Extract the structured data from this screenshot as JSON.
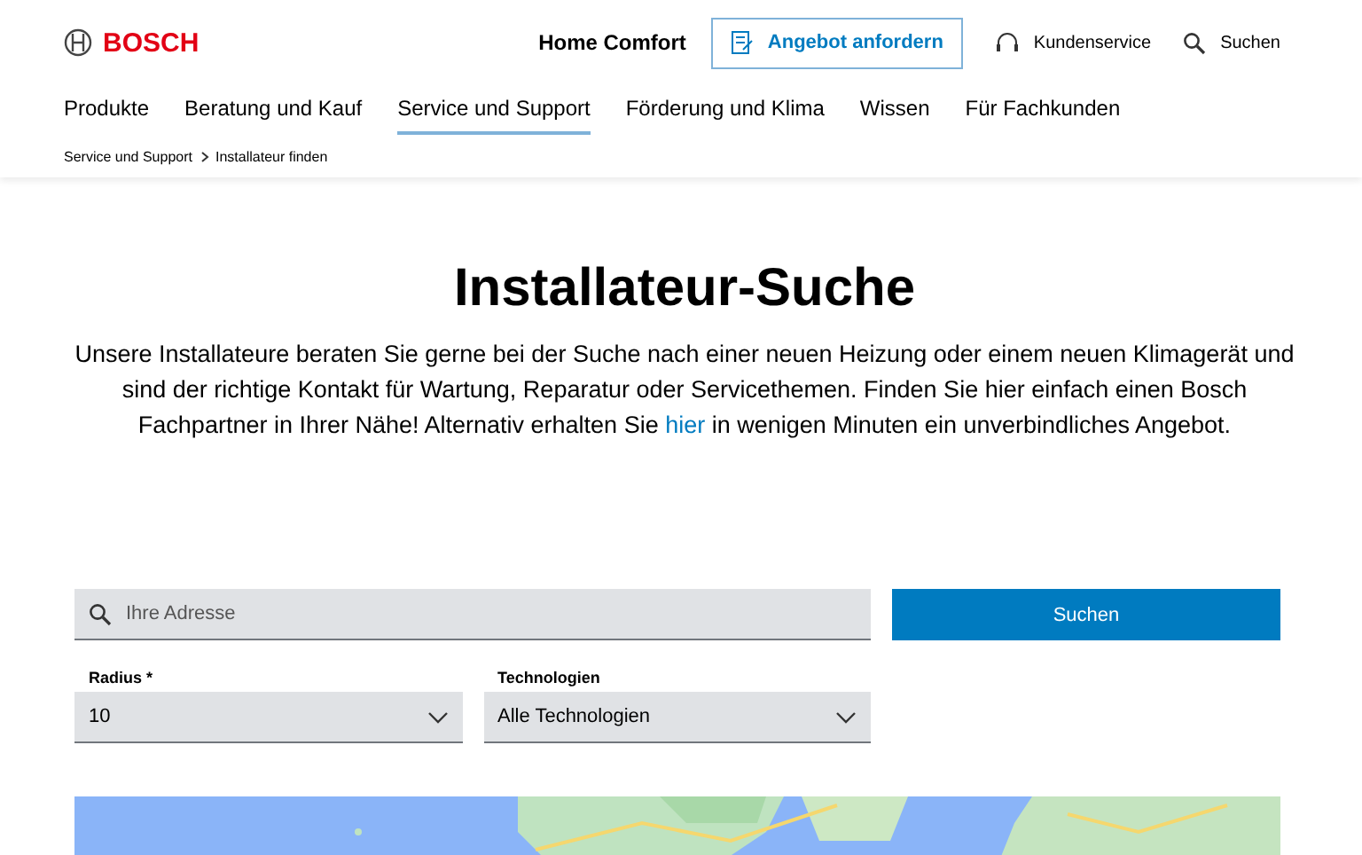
{
  "brand": "BOSCH",
  "header": {
    "title": "Home Comfort",
    "cta": "Angebot anfordern",
    "links": [
      "Kundenservice",
      "Suchen"
    ]
  },
  "nav": [
    {
      "label": "Produkte",
      "selected": false
    },
    {
      "label": "Beratung und Kauf",
      "selected": false
    },
    {
      "label": "Service und Support",
      "selected": true
    },
    {
      "label": "Förderung und Klima",
      "selected": false
    },
    {
      "label": "Wissen",
      "selected": false
    },
    {
      "label": "Für Fachkunden",
      "selected": false
    }
  ],
  "breadcrumb": [
    "Service und Support",
    "Installateur finden"
  ],
  "heading": "Installateur-Suche",
  "intro": {
    "before": "Unsere Installateure beraten Sie gerne bei der Suche nach einer neuen Heizung oder einem neuen Klimagerät und sind der richtige Kontakt für Wartung, Reparatur oder Servicethemen. Finden Sie hier einfach einen Bosch Fachpartner in Ihrer Nähe! Alternativ erhalten Sie ",
    "link": "hier",
    "after": " in wenigen Minuten ein unverbindliches Angebot."
  },
  "search": {
    "placeholder": "Ihre Adresse",
    "button": "Suchen"
  },
  "selects": [
    {
      "label": "Radius *",
      "value": "10"
    },
    {
      "label": "Technologien",
      "value": "Alle Technologien"
    }
  ]
}
